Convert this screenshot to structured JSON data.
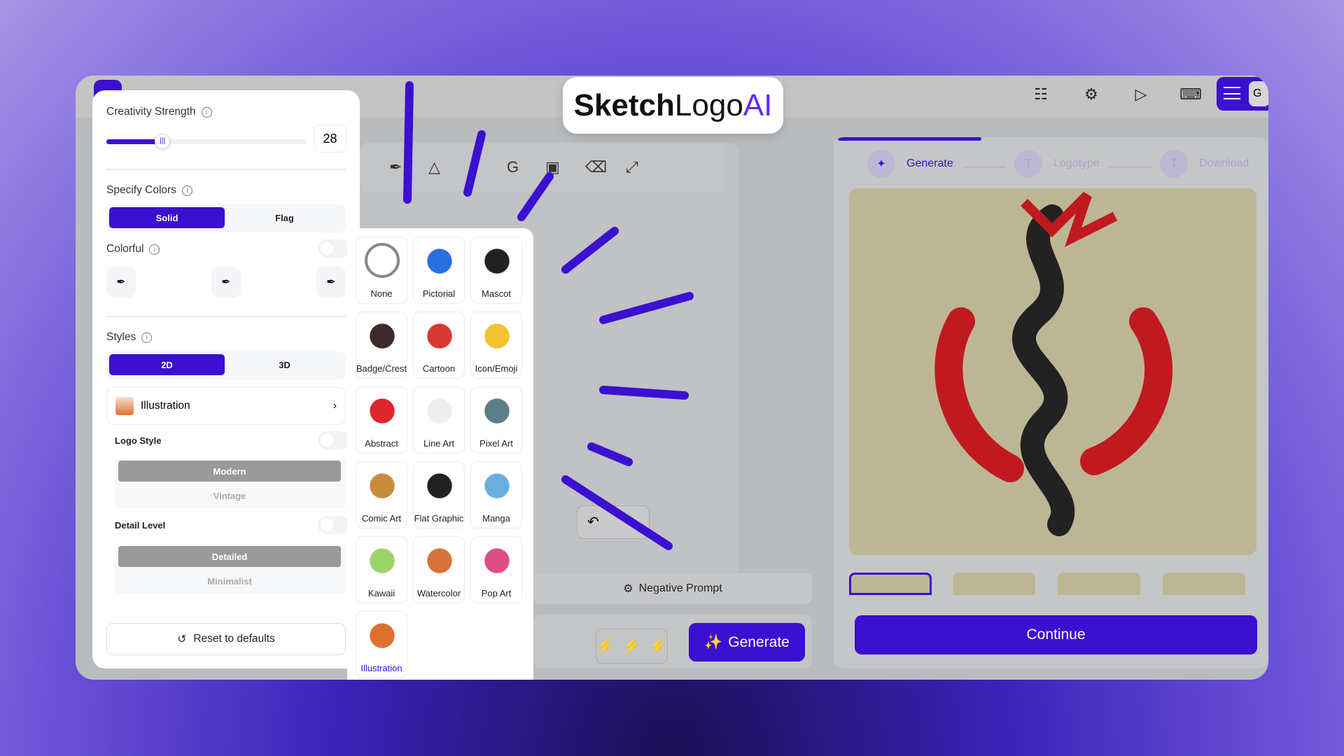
{
  "brand": {
    "part1": "Sketch",
    "part2": "Logo",
    "part3": "AI"
  },
  "topbar": {
    "icons": [
      "book-icon",
      "bug-icon",
      "video-icon",
      "keyboard-icon"
    ],
    "avatar_letter": "G"
  },
  "panel": {
    "creativity": {
      "label": "Creativity Strength",
      "value": 28,
      "max": 100,
      "value_text": "28"
    },
    "colors": {
      "label": "Specify Colors",
      "options": [
        "Solid",
        "Flag"
      ],
      "selected": "Solid"
    },
    "colorful": {
      "label": "Colorful",
      "enabled": false
    },
    "styles": {
      "label": "Styles",
      "options": [
        "2D",
        "3D"
      ],
      "selected": "2D",
      "current": "Illustration"
    },
    "logo_style": {
      "label": "Logo Style",
      "options": [
        "Modern",
        "Vintage"
      ],
      "selected": "Modern"
    },
    "detail_level": {
      "label": "Detail Level",
      "options": [
        "Detailed",
        "Minimalist"
      ],
      "selected": "Detailed"
    },
    "reset": "Reset to defaults"
  },
  "style_grid": [
    "None",
    "Pictorial",
    "Mascot",
    "Badge/Crest",
    "Cartoon",
    "Icon/Emoji",
    "Abstract",
    "Line Art",
    "Pixel Art",
    "Comic Art",
    "Flat Graphic",
    "Manga",
    "Kawaii",
    "Watercolor",
    "Pop Art",
    "Illustration"
  ],
  "style_selected": "Illustration",
  "center": {
    "negative_prompt": "Negative Prompt",
    "generate": "Generate"
  },
  "right": {
    "steps": [
      "Generate",
      "Logotype",
      "Download"
    ],
    "active_step": "Generate",
    "continue": "Continue"
  },
  "colors": {
    "accent": "#3b10d0"
  }
}
